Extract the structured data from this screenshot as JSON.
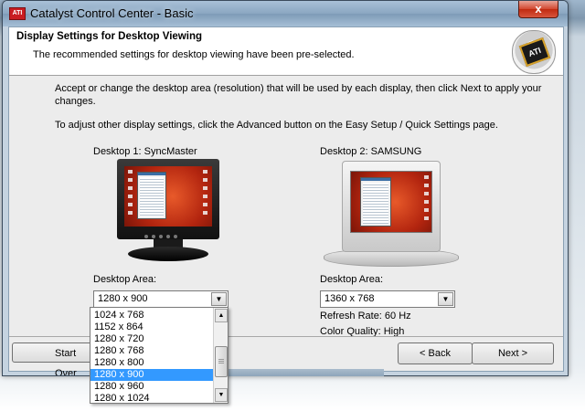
{
  "window": {
    "title": "Catalyst Control Center - Basic",
    "close_glyph": "x",
    "app_icon_text": "ATI"
  },
  "header": {
    "title": "Display Settings for Desktop Viewing",
    "subtitle": "The recommended settings for desktop viewing have been pre-selected.",
    "badge_text": "ATI"
  },
  "body": {
    "paragraph1": "Accept or change the desktop area (resolution) that will be used by each display, then click Next to apply your changes.",
    "paragraph2": "To adjust other display settings, click the Advanced button on the Easy Setup / Quick Settings page."
  },
  "desktop1": {
    "label": "Desktop 1: SyncMaster",
    "area_label": "Desktop Area:",
    "area_value": "1280 x  900"
  },
  "desktop2": {
    "label": "Desktop 2: SAMSUNG",
    "area_label": "Desktop Area:",
    "area_value": "1360 x 768",
    "refresh_rate": "Refresh Rate: 60 Hz",
    "color_quality": "Color Quality: High"
  },
  "dropdown": {
    "options": [
      "1024 x  768",
      "1152 x  864",
      "1280 x  720",
      "1280 x  768",
      "1280 x  800",
      "1280 x  900",
      "1280 x  960",
      "1280 x 1024"
    ],
    "selected_index": 5
  },
  "footer": {
    "start_over": "Start Over",
    "back": "< Back",
    "next": "Next >"
  },
  "icons": {
    "dropdown_arrow": "chevron-down-icon",
    "scroll_up": "scroll-up-icon",
    "scroll_down": "scroll-down-icon"
  },
  "colors": {
    "selection": "#3399ff",
    "close_button": "#c02a10",
    "desktop_wallpaper": "#b3250f"
  }
}
